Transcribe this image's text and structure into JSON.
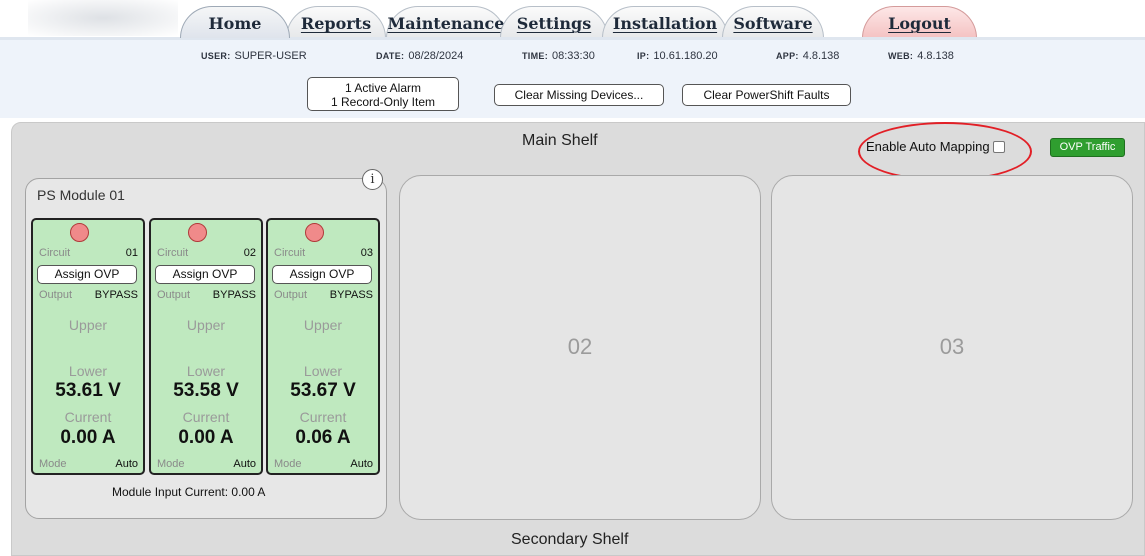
{
  "tabs": [
    {
      "label": "Home",
      "active": true
    },
    {
      "label": "Reports"
    },
    {
      "label": "Maintenance"
    },
    {
      "label": "Settings"
    },
    {
      "label": "Installation"
    },
    {
      "label": "Software"
    },
    {
      "label": "Logout"
    }
  ],
  "info": {
    "user_key": "USER:",
    "user": "SUPER-USER",
    "date_key": "DATE:",
    "date": "08/28/2024",
    "time_key": "TIME:",
    "time": "08:33:30",
    "ip_key": "IP:",
    "ip": "10.61.180.20",
    "app_key": "APP:",
    "app": "4.8.138",
    "web_key": "WEB:",
    "web": "4.8.138"
  },
  "alarms": {
    "line1": "1 Active Alarm",
    "line2": "1 Record-Only Item"
  },
  "buttons": {
    "clear_missing": "Clear Missing Devices...",
    "clear_powershift": "Clear PowerShift Faults"
  },
  "main_shelf": {
    "title": "Main Shelf",
    "auto_mapping_label": "Enable Auto Mapping",
    "auto_mapping_checked": false,
    "ovp_traffic": "OVP Traffic",
    "ovp_traffic_color": "#2f9e2f"
  },
  "ps_module": {
    "title": "PS Module 01",
    "info_icon": "i",
    "input_current": "Module Input Current: 0.00 A",
    "circuits": [
      {
        "circuit_label": "Circuit",
        "circuit": "01",
        "assign": "Assign OVP",
        "output_label": "Output",
        "output": "BYPASS",
        "upper": "Upper",
        "lower": "Lower",
        "voltage": "53.61 V",
        "current_label": "Current",
        "current": "0.00 A",
        "mode_label": "Mode",
        "mode": "Auto"
      },
      {
        "circuit_label": "Circuit",
        "circuit": "02",
        "assign": "Assign OVP",
        "output_label": "Output",
        "output": "BYPASS",
        "upper": "Upper",
        "lower": "Lower",
        "voltage": "53.58 V",
        "current_label": "Current",
        "current": "0.00 A",
        "mode_label": "Mode",
        "mode": "Auto"
      },
      {
        "circuit_label": "Circuit",
        "circuit": "03",
        "assign": "Assign OVP",
        "output_label": "Output",
        "output": "BYPASS",
        "upper": "Upper",
        "lower": "Lower",
        "voltage": "53.67 V",
        "current_label": "Current",
        "current": "0.06 A",
        "mode_label": "Mode",
        "mode": "Auto"
      }
    ]
  },
  "slots": [
    "02",
    "03"
  ],
  "secondary_shelf": {
    "title": "Secondary Shelf"
  },
  "colors": {
    "led_alarm": "#f08a8a",
    "circuit_bg": "#bfe9bf",
    "highlight": "#e21f26"
  }
}
